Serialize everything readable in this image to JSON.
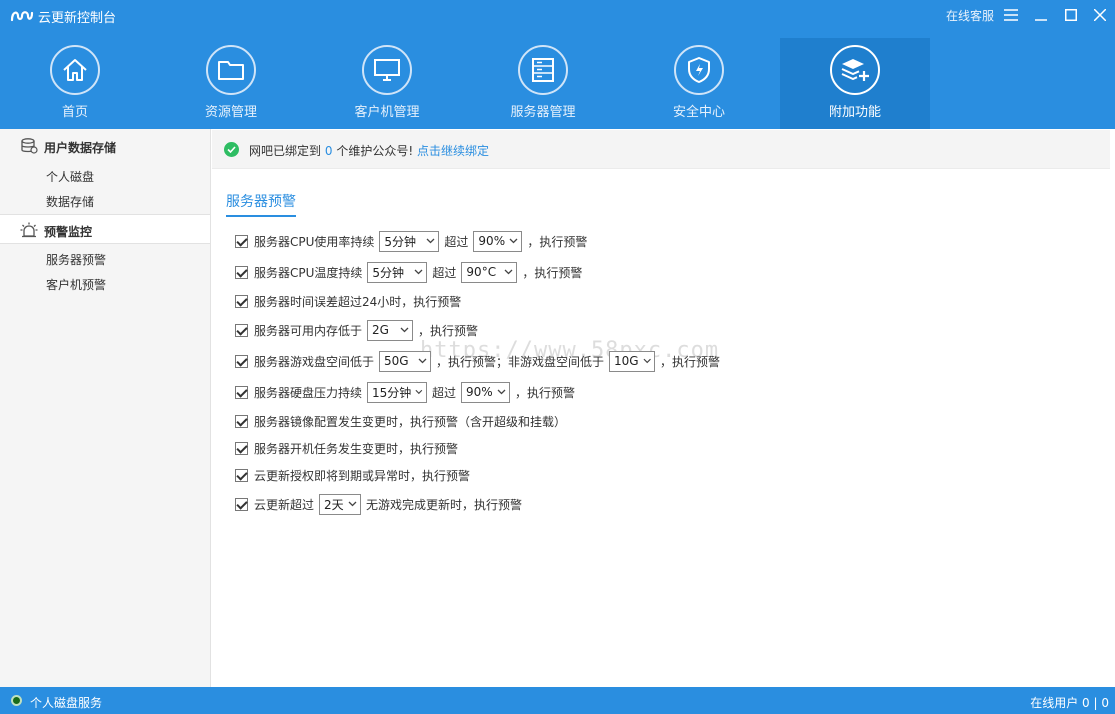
{
  "window": {
    "title": "云更新控制台",
    "service_link": "在线客服"
  },
  "nav": [
    {
      "label": "首页",
      "icon": "home-icon"
    },
    {
      "label": "资源管理",
      "icon": "folder-icon"
    },
    {
      "label": "客户机管理",
      "icon": "monitor-icon"
    },
    {
      "label": "服务器管理",
      "icon": "server-icon"
    },
    {
      "label": "安全中心",
      "icon": "shield-icon"
    },
    {
      "label": "附加功能",
      "icon": "layers-plus-icon",
      "active": true
    }
  ],
  "sidebar": {
    "groups": [
      {
        "label": "用户数据存储",
        "icon": "database-icon",
        "items": [
          "个人磁盘",
          "数据存储"
        ]
      },
      {
        "label": "预警监控",
        "icon": "alarm-icon",
        "selected": true,
        "items": [
          "服务器预警",
          "客户机预警"
        ]
      }
    ]
  },
  "notice": {
    "prefix": "网吧已绑定到",
    "count": "0",
    "suffix": "个维护公众号!",
    "link": "点击继续绑定"
  },
  "section_title": "服务器预警",
  "rules": {
    "r1": {
      "a": "服务器CPU使用率持续",
      "s1": "5分钟",
      "b": "超过",
      "s2": "90%",
      "c": "，执行预警"
    },
    "r2": {
      "a": "服务器CPU温度持续",
      "s1": "5分钟",
      "b": "超过",
      "s2": "90°C",
      "c": "，执行预警"
    },
    "r3": {
      "a": "服务器时间误差超过24小时，执行预警"
    },
    "r4": {
      "a": "服务器可用内存低于",
      "s1": "2G",
      "c": "，执行预警"
    },
    "r5": {
      "a": "服务器游戏盘空间低于",
      "s1": "50G",
      "b": "，执行预警；非游戏盘空间低于",
      "s2": "10G",
      "c": "，执行预警"
    },
    "r6": {
      "a": "服务器硬盘压力持续",
      "s1": "15分钟",
      "b": "超过",
      "s2": "90%",
      "c": "，执行预警"
    },
    "r7": {
      "a": "服务器镜像配置发生变更时，执行预警（含开超级和挂载）"
    },
    "r8": {
      "a": "服务器开机任务发生变更时，执行预警"
    },
    "r9": {
      "a": "云更新授权即将到期或异常时，执行预警"
    },
    "r10": {
      "a": "云更新超过",
      "s1": "2天",
      "b": "无游戏完成更新时，执行预警"
    }
  },
  "statusbar": {
    "left": "个人磁盘服务",
    "right": "在线用户 0 | 0"
  },
  "watermark": "https://www.58pxc.com",
  "colors": {
    "accent": "#2a8ee0",
    "success": "#2ebd63"
  }
}
